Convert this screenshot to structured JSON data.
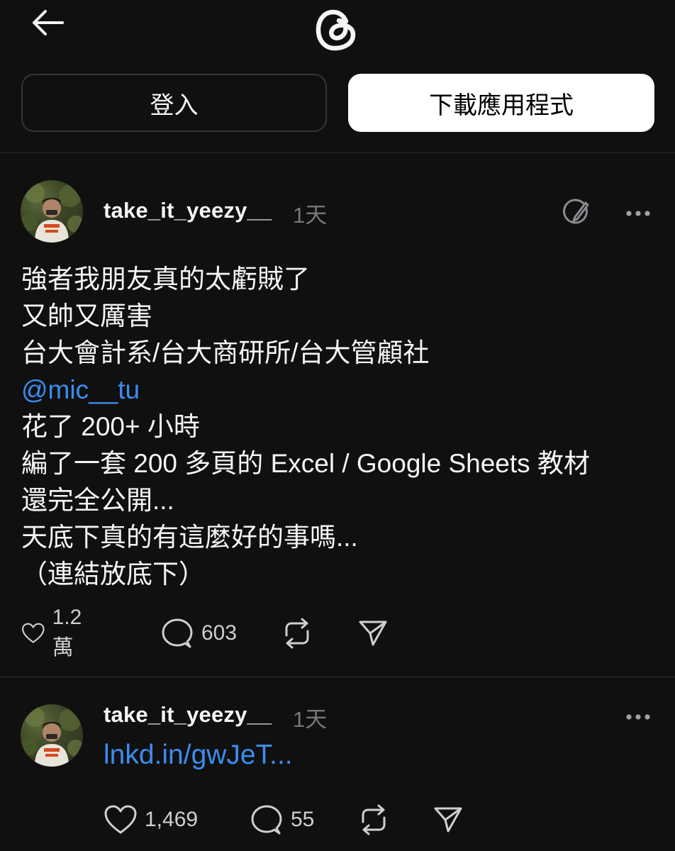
{
  "header": {
    "back_icon": "arrow-left-icon",
    "logo_icon": "threads-logo-icon"
  },
  "auth": {
    "login_label": "登入",
    "download_label": "下載應用程式"
  },
  "posts": [
    {
      "username": "take_it_yeezy__",
      "time": "1天",
      "edit_icon": "edit-icon",
      "more_icon": "more-icon",
      "body": {
        "lines": [
          "強者我朋友真的太虧賊了",
          "又帥又厲害",
          "台大會計系/台大商研所/台大管顧社"
        ],
        "mention": "@mic__tu",
        "lines_after": [
          "花了 200+ 小時",
          "編了一套 200 多頁的 Excel / Google Sheets 教材",
          "還完全公開...",
          "天底下真的有這麼好的事嗎...",
          "（連結放底下）"
        ]
      },
      "likes": "1.2 萬",
      "replies": "603"
    },
    {
      "username": "take_it_yeezy__",
      "time": "1天",
      "more_icon": "more-icon",
      "link": "lnkd.in/gwJeT...",
      "likes": "1,469",
      "replies": "55"
    }
  ],
  "colors": {
    "background": "#101010",
    "text": "#f3f5f7",
    "secondary": "#777777",
    "link": "#3b8df0",
    "divider": "#2a2c2e"
  }
}
